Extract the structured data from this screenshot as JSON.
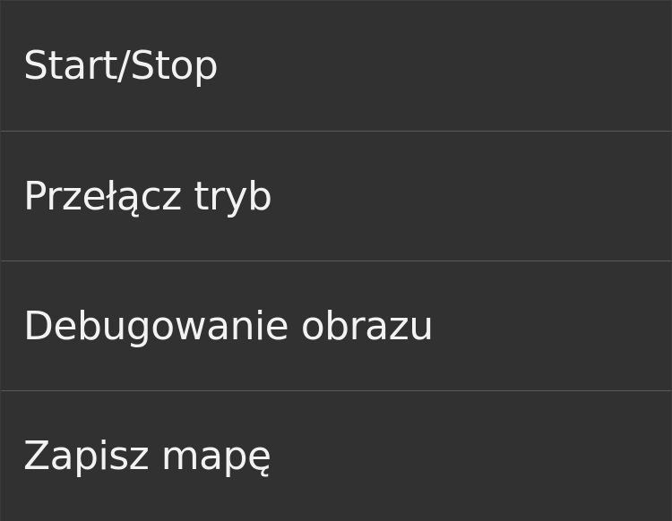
{
  "menu": {
    "items": [
      {
        "label": "Start/Stop"
      },
      {
        "label": "Przełącz tryb"
      },
      {
        "label": "Debugowanie obrazu"
      },
      {
        "label": "Zapisz mapę"
      }
    ]
  },
  "colors": {
    "background": "#313131",
    "divider": "#595959",
    "text": "#f2f2f2"
  }
}
